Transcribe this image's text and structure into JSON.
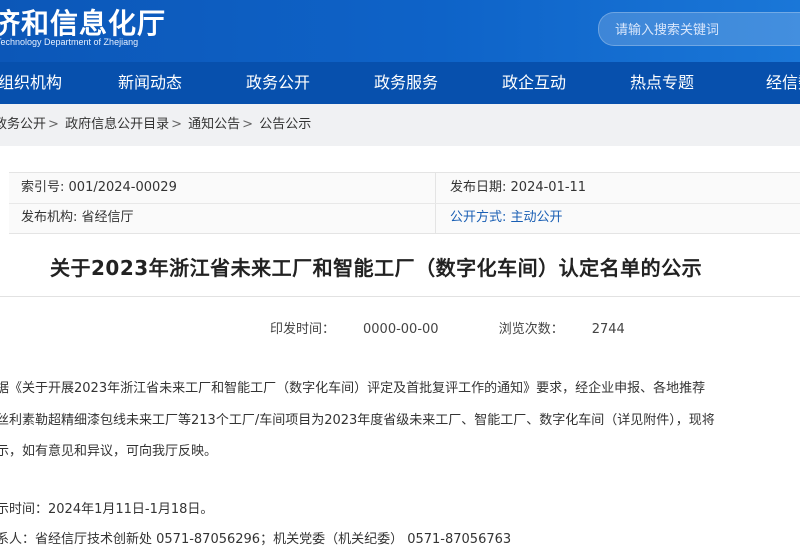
{
  "header": {
    "site_title": "济和信息化厅",
    "site_subtitle": "Technology Department of Zhejiang",
    "search_placeholder": "请输入搜索关键词"
  },
  "nav": {
    "items": [
      "组织机构",
      "新闻动态",
      "政务公开",
      "政务服务",
      "政企互动",
      "热点专题",
      "经信数"
    ]
  },
  "breadcrumb": {
    "items": [
      "政务公开",
      "政府信息公开目录",
      "通知公告",
      "公告公示"
    ],
    "separator": ">"
  },
  "meta": {
    "index_label": "索引号:",
    "index_value": "001/2024-00029",
    "publish_date_label": "发布日期:",
    "publish_date_value": "2024-01-11",
    "issuer_label": "发布机构:",
    "issuer_value": "省经信厅",
    "disclosure_label": "公开方式:",
    "disclosure_value": "主动公开"
  },
  "article": {
    "title": "关于2023年浙江省未来工厂和智能工厂（数字化车间）认定名单的公示",
    "print_time_label": "印发时间：",
    "print_time_value": "0000-00-00",
    "views_label": "浏览次数：",
    "views_value": "2744",
    "paragraphs": [
      "据《关于开展2023年浙江省未来工厂和智能工厂（数字化车间）评定及首批复评工作的通知》要求，经企业申报、各地推荐",
      "丝利素勒超精细漆包线未来工厂等213个工厂/车间项目为2023年度省级未来工厂、智能工厂、数字化车间（详见附件），现将",
      "示，如有意见和异议，可向我厅反映。",
      "示时间：2024年1月11日-1月18日。",
      "系人：省经信厅技术创新处 0571-87056296；机关党委（机关纪委） 0571-87056763"
    ]
  }
}
